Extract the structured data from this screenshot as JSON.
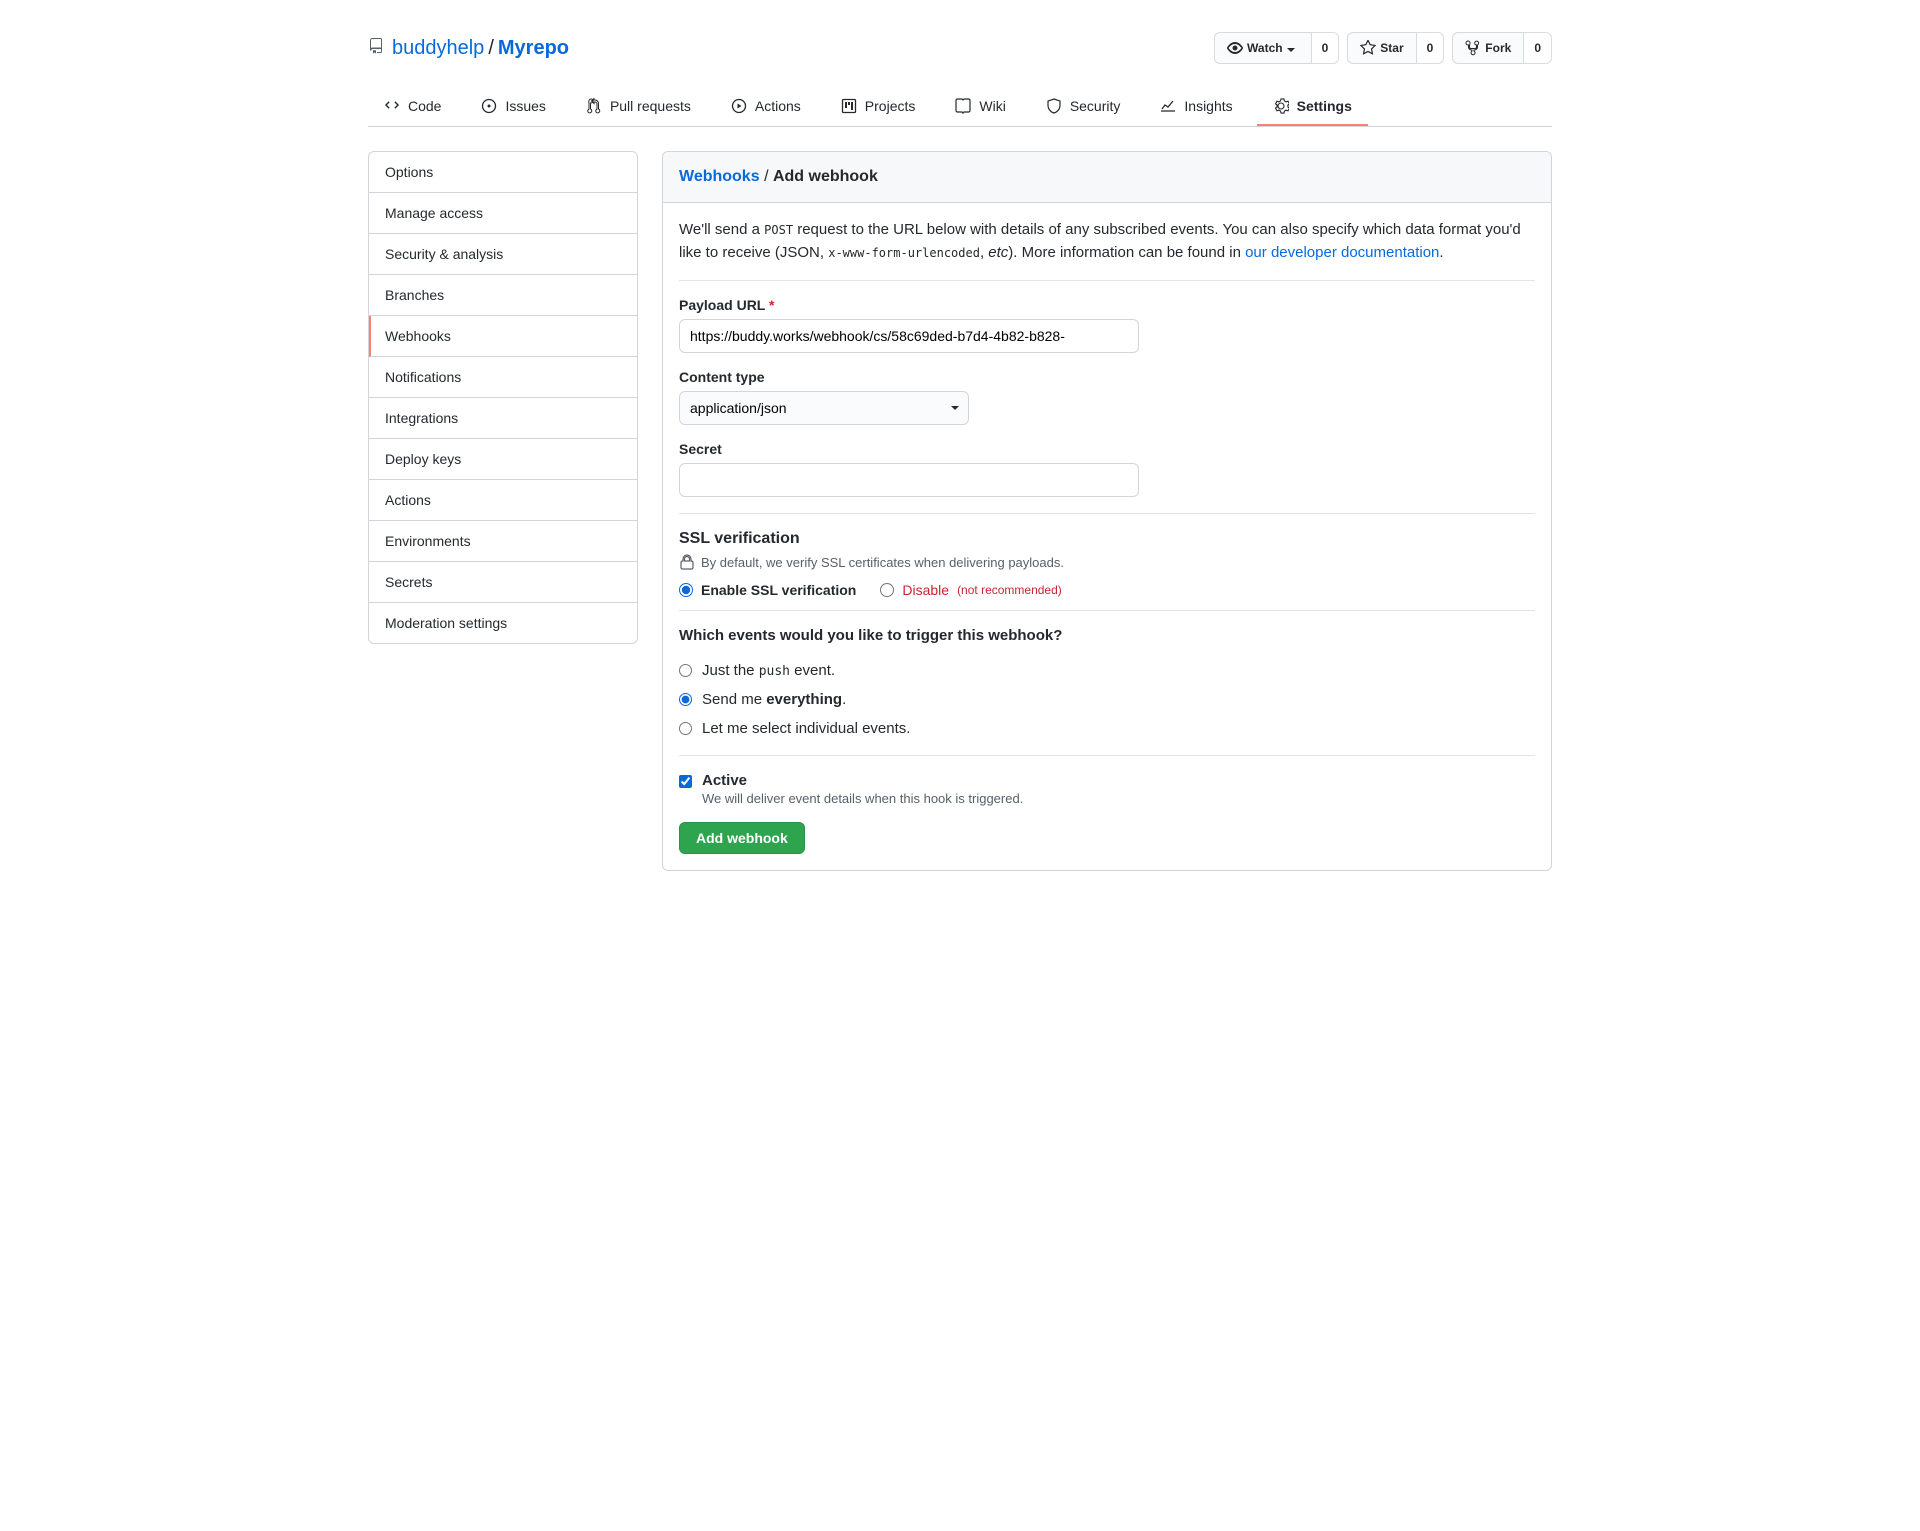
{
  "breadcrumb": {
    "owner": "buddyhelp",
    "sep": "/",
    "repo": "Myrepo"
  },
  "actions": {
    "watch": {
      "label": "Watch",
      "count": "0"
    },
    "star": {
      "label": "Star",
      "count": "0"
    },
    "fork": {
      "label": "Fork",
      "count": "0"
    }
  },
  "tabs": [
    {
      "label": "Code"
    },
    {
      "label": "Issues"
    },
    {
      "label": "Pull requests"
    },
    {
      "label": "Actions"
    },
    {
      "label": "Projects"
    },
    {
      "label": "Wiki"
    },
    {
      "label": "Security"
    },
    {
      "label": "Insights"
    },
    {
      "label": "Settings"
    }
  ],
  "sidebar": {
    "items": [
      "Options",
      "Manage access",
      "Security & analysis",
      "Branches",
      "Webhooks",
      "Notifications",
      "Integrations",
      "Deploy keys",
      "Actions",
      "Environments",
      "Secrets",
      "Moderation settings"
    ]
  },
  "header": {
    "link": "Webhooks",
    "sep": "/",
    "current": "Add webhook"
  },
  "intro": {
    "pre": "We'll send a ",
    "code1": "POST",
    "mid1": " request to the URL below with details of any subscribed events. You can also specify which data format you'd like to receive (JSON, ",
    "code2": "x-www-form-urlencoded",
    "mid2": ", ",
    "em": "etc",
    "mid3": "). More information can be found in ",
    "link": "our developer documentation",
    "tail": "."
  },
  "form": {
    "payload": {
      "label": "Payload URL",
      "value": "https://buddy.works/webhook/cs/58c69ded-b7d4-4b82-b828-"
    },
    "content_type": {
      "label": "Content type",
      "value": "application/json"
    },
    "secret": {
      "label": "Secret",
      "value": ""
    },
    "ssl": {
      "title": "SSL verification",
      "note": "By default, we verify SSL certificates when delivering payloads.",
      "enable": "Enable SSL verification",
      "disable": "Disable",
      "not_rec": "(not recommended)"
    },
    "events": {
      "title": "Which events would you like to trigger this webhook?",
      "opt_push_pre": "Just the ",
      "opt_push_code": "push",
      "opt_push_post": " event.",
      "opt_everything_pre": "Send me ",
      "opt_everything_strong": "everything",
      "opt_everything_post": ".",
      "opt_select": "Let me select individual events."
    },
    "active": {
      "label": "Active",
      "note": "We will deliver event details when this hook is triggered."
    },
    "submit": "Add webhook"
  }
}
